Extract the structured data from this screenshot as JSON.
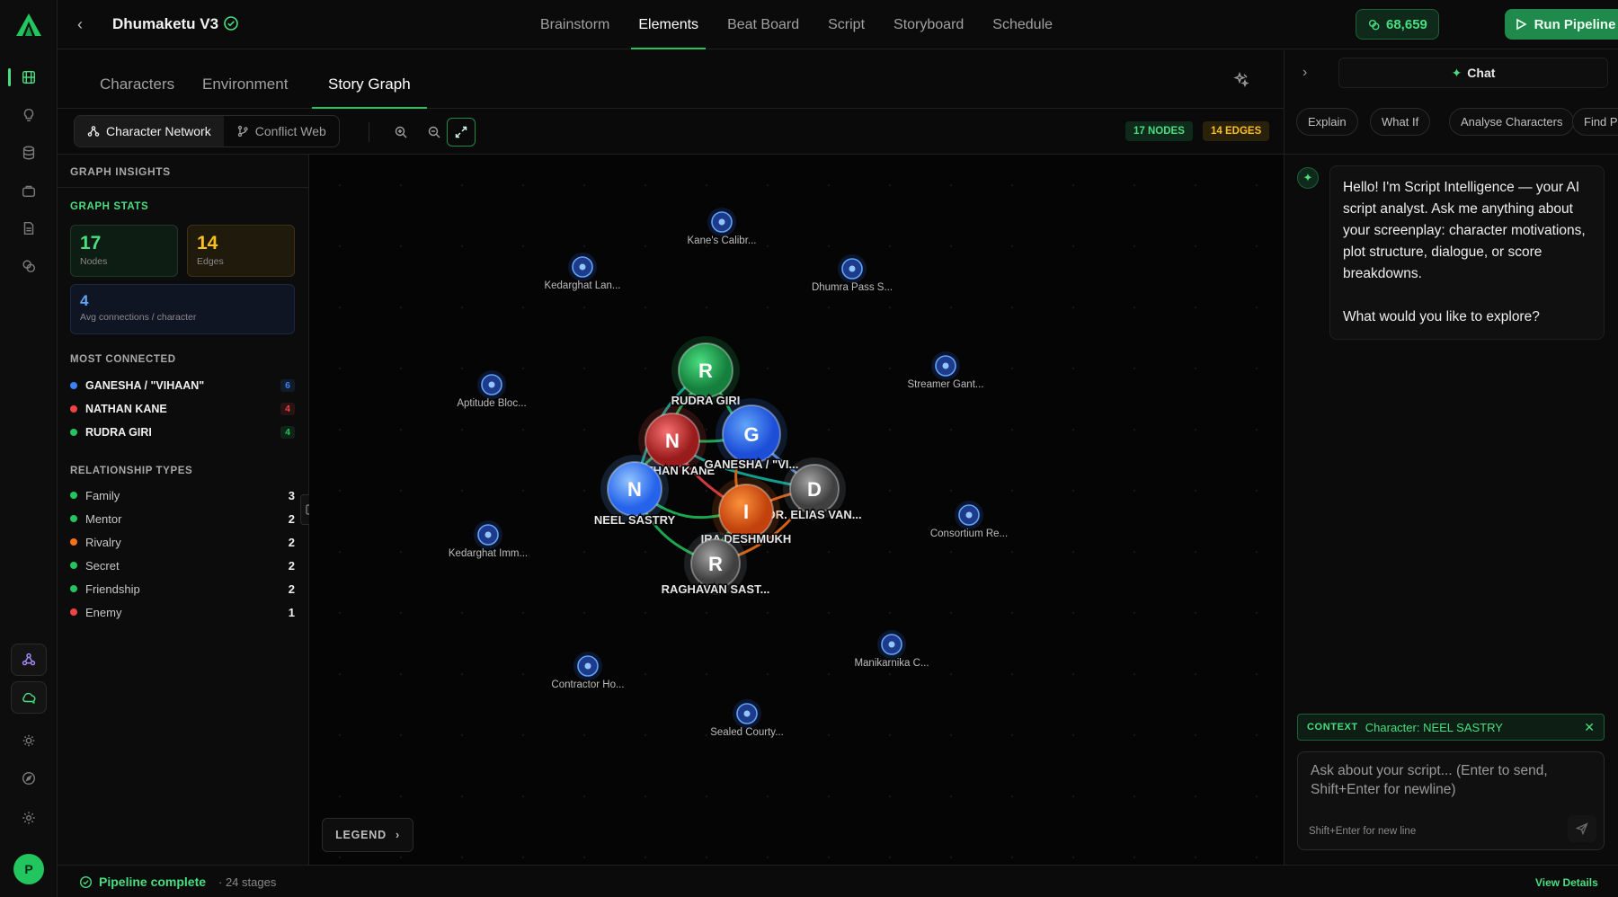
{
  "app": {
    "brand_icon": "triangle-logo-icon"
  },
  "rail": {
    "items": [
      {
        "icon": "film-icon",
        "active": true
      },
      {
        "icon": "lightbulb-icon"
      },
      {
        "icon": "database-icon"
      },
      {
        "icon": "briefcase-icon"
      },
      {
        "icon": "document-icon"
      },
      {
        "icon": "coins-icon"
      }
    ],
    "bottom": [
      {
        "icon": "network-icon"
      },
      {
        "icon": "cloud-icon"
      },
      {
        "icon": "sun-icon"
      },
      {
        "icon": "compass-icon"
      },
      {
        "icon": "gear-icon"
      }
    ],
    "avatar_initial": "P"
  },
  "header": {
    "project_title": "Dhumaketu V3",
    "nav": [
      "Brainstorm",
      "Elements",
      "Beat Board",
      "Script",
      "Storyboard",
      "Schedule"
    ],
    "active_nav": "Elements",
    "credits": "68,659",
    "run_label": "Run Pipeline"
  },
  "subtabs": {
    "items": [
      "Characters",
      "Environment",
      "Story Graph"
    ],
    "active": "Story Graph"
  },
  "toolbar": {
    "modes": [
      "Character Network",
      "Conflict Web"
    ],
    "active_mode": "Character Network",
    "nodes_badge": "17 NODES",
    "edges_badge": "14 EDGES"
  },
  "insights": {
    "heading": "GRAPH INSIGHTS",
    "stats_label": "GRAPH STATS",
    "nodes_value": "17",
    "nodes_label": "Nodes",
    "edges_value": "14",
    "edges_label": "Edges",
    "avg_value": "4",
    "avg_label": "Avg connections / character",
    "most_connected_label": "MOST CONNECTED",
    "most_connected": [
      {
        "name": "GANESHA / \"VIHAAN\"",
        "count": "6",
        "color": "#3b82f6"
      },
      {
        "name": "NATHAN KANE",
        "count": "4",
        "color": "#ef4444"
      },
      {
        "name": "RUDRA GIRI",
        "count": "4",
        "color": "#22c55e"
      }
    ],
    "relationship_label": "RELATIONSHIP TYPES",
    "relationships": [
      {
        "name": "Family",
        "count": "3",
        "color": "#22c55e"
      },
      {
        "name": "Mentor",
        "count": "2",
        "color": "#22c55e"
      },
      {
        "name": "Rivalry",
        "count": "2",
        "color": "#f97316"
      },
      {
        "name": "Secret",
        "count": "2",
        "color": "#22c55e"
      },
      {
        "name": "Friendship",
        "count": "2",
        "color": "#22c55e"
      },
      {
        "name": "Enemy",
        "count": "1",
        "color": "#ef4444"
      }
    ]
  },
  "graph": {
    "characters": [
      {
        "initial": "R",
        "label": "RUDRA GIRI",
        "color": "#22c55e"
      },
      {
        "initial": "N",
        "label": "NATHAN KANE",
        "color": "#ef4444"
      },
      {
        "initial": "G",
        "label": "GANESHA / \"VI...",
        "color": "#3b82f6"
      },
      {
        "initial": "N",
        "label": "NEEL SASTRY",
        "color": "#60a5fa"
      },
      {
        "initial": "D",
        "label": "DR. ELIAS VAN...",
        "color": "#9ca3af"
      },
      {
        "initial": "I",
        "label": "IRA DESHMUKH",
        "color": "#f97316"
      },
      {
        "initial": "R",
        "label": "RAGHAVAN SAST...",
        "color": "#9ca3af"
      }
    ],
    "locations": [
      "Kane's Calibr...",
      "Kedarghat Lan...",
      "Dhumra Pass S...",
      "Aptitude Bloc...",
      "Streamer Gant...",
      "Consortium Re...",
      "Kedarghat Imm...",
      "Contractor Ho...",
      "Manikarnika C...",
      "Sealed Courty..."
    ],
    "legend_label": "LEGEND"
  },
  "chat": {
    "tab_label": "Chat",
    "chips": [
      "Explain",
      "What If",
      "Analyse Characters",
      "Find P"
    ],
    "message": "Hello! I'm Script Intelligence — your AI script analyst. Ask me anything about your screenplay: character motivations, plot structure, dialogue, or score breakdowns.\n\nWhat would you like to explore?",
    "context_key": "CONTEXT",
    "context_value": "Character: NEEL SASTRY",
    "input_placeholder": "Ask about your script... (Enter to send, Shift+Enter for newline)",
    "hint": "Shift+Enter for new line"
  },
  "status": {
    "complete": "Pipeline complete",
    "stages": "· 24 stages",
    "view_details": "View Details"
  }
}
